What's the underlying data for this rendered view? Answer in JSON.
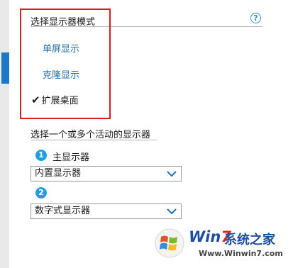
{
  "display_mode": {
    "title": "选择显示器模式",
    "options": [
      {
        "label": "单屏显示",
        "selected": false
      },
      {
        "label": "克隆显示",
        "selected": false
      },
      {
        "label": "扩展桌面",
        "selected": true
      }
    ],
    "help_glyph": "?"
  },
  "active_displays": {
    "title": "选择一个或多个活动的显示器",
    "monitors": [
      {
        "number": "1",
        "label": "主显示器",
        "selection": "内置显示器"
      },
      {
        "number": "2",
        "label": "",
        "selection": "数字式显示器"
      }
    ]
  },
  "watermark": {
    "brand_prefix": "Win",
    "brand_digit": "7",
    "brand_cn": "系统之家",
    "url": "Www.Winwin7.com"
  },
  "colors": {
    "accent": "#1e78c8",
    "link": "#1d6fa8",
    "highlight_border": "#d81e1e",
    "badge": "#1ea0e0"
  }
}
